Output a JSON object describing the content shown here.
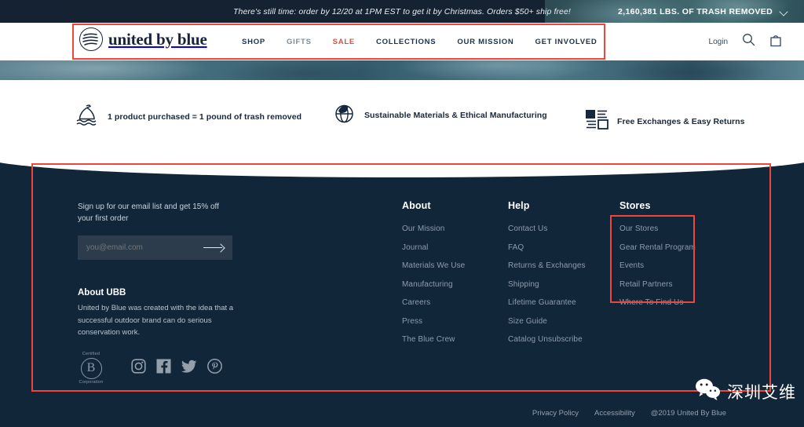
{
  "announcement": {
    "message": "There's still time: order by 12/20 at 1PM EST to get it by Christmas. Orders $50+ ship free!",
    "counter": "2,160,381 LBS. OF TRASH REMOVED",
    "chevron_icon": "chevron-down-icon"
  },
  "header": {
    "logo_text": "united by blue",
    "logo_icon": "wave-circle-logo-icon",
    "nav": [
      {
        "label": "SHOP",
        "style": "dark"
      },
      {
        "label": "GIFTS",
        "style": "muted"
      },
      {
        "label": "SALE",
        "style": "sale"
      },
      {
        "label": "COLLECTIONS",
        "style": "dark"
      },
      {
        "label": "OUR MISSION",
        "style": "dark"
      },
      {
        "label": "GET INVOLVED",
        "style": "dark"
      }
    ],
    "login_label": "Login",
    "search_icon": "search-icon",
    "bag_icon": "shopping-bag-icon"
  },
  "value_props": [
    {
      "icon": "trash-bag-in-water-icon",
      "label": "1 product purchased = 1 pound of trash removed"
    },
    {
      "icon": "globe-leaf-icon",
      "label": "Sustainable Materials & Ethical Manufacturing"
    },
    {
      "icon": "exchange-boxes-icon",
      "label": "Free Exchanges & Easy Returns"
    }
  ],
  "footer": {
    "signup": {
      "text": "Sign up for our email list and get 15% off your first order",
      "placeholder": "you@email.com",
      "value": "",
      "submit_icon": "arrow-right-icon"
    },
    "about_ubb": {
      "title": "About UBB",
      "body": "United by Blue was created with the idea that a successful outdoor brand can do serious conservation work."
    },
    "columns": [
      {
        "heading": "About",
        "links": [
          "Our Mission",
          "Journal",
          "Materials We Use",
          "Manufacturing",
          "Careers",
          "Press",
          "The Blue Crew"
        ]
      },
      {
        "heading": "Help",
        "links": [
          "Contact Us",
          "FAQ",
          "Returns & Exchanges",
          "Shipping",
          "Lifetime Guarantee",
          "Size Guide",
          "Catalog Unsubscribe"
        ]
      },
      {
        "heading": "Stores",
        "links": [
          "Our Stores",
          "Gear Rental Program",
          "Events",
          "Retail Partners",
          "Where To Find Us"
        ]
      }
    ],
    "bcorp": {
      "top": "Certified",
      "letter": "B",
      "bottom": "Corporation"
    },
    "socials": [
      {
        "icon": "instagram-icon"
      },
      {
        "icon": "facebook-icon"
      },
      {
        "icon": "twitter-icon"
      },
      {
        "icon": "pinterest-icon"
      }
    ],
    "bottom_bar": {
      "privacy": "Privacy Policy",
      "accessibility": "Accessibility",
      "copyright": "@2019 United By Blue"
    }
  },
  "watermark": {
    "icon": "wechat-icon",
    "text": "深圳艾维"
  },
  "colors": {
    "footer_bg": "#12263a",
    "announce_bg": "#142232",
    "sale_red": "#cf5242",
    "highlight_red": "#f0453a",
    "input_bg": "#2c3c4c"
  }
}
